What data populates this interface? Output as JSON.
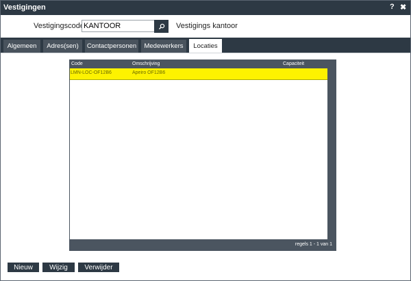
{
  "window": {
    "title": "Vestigingen",
    "help_label": "?",
    "close_label": "✖"
  },
  "code": {
    "label": "Vestigingscode:",
    "value": "KANTOOR",
    "description": "Vestigings kantoor"
  },
  "tabs": [
    {
      "label": "Algemeen"
    },
    {
      "label": "Adres(sen)"
    },
    {
      "label": "Contactpersonen"
    },
    {
      "label": "Medewerkers"
    },
    {
      "label": "Locaties",
      "active": true
    }
  ],
  "table": {
    "columns": [
      "Code",
      "Omschrijving",
      "Capaciteit"
    ],
    "rows": [
      {
        "code": "LMN-LOC-OF12B6",
        "omschrijving": "Apeiro OF12B6",
        "capaciteit": ""
      }
    ],
    "footer": "regels 1 - 1 van 1"
  },
  "buttons": {
    "new": "Nieuw",
    "edit": "Wijzig",
    "delete": "Verwijder"
  },
  "colors": {
    "header": "#2d3944",
    "selected_row": "#fdf200"
  }
}
